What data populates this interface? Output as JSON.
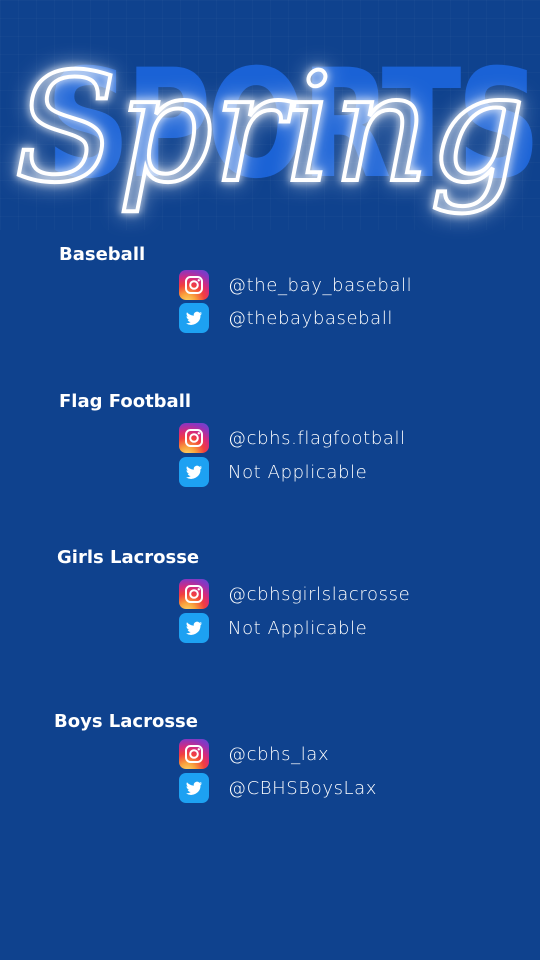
{
  "header": {
    "background_word": "SPORTS",
    "neon_word": "Spring"
  },
  "colors": {
    "background": "#0f428e",
    "background_word": "#1a62d6",
    "twitter": "#1da1f2",
    "text": "#ffffff"
  },
  "sports": [
    {
      "name": "Baseball",
      "instagram": "@the_bay_baseball",
      "twitter": "@thebaybaseball"
    },
    {
      "name": "Flag Football",
      "instagram": "@cbhs.flagfootball",
      "twitter": "Not Applicable"
    },
    {
      "name": "Girls Lacrosse",
      "instagram": "@cbhsgirlslacrosse",
      "twitter": "Not Applicable"
    },
    {
      "name": "Boys Lacrosse",
      "instagram": "@cbhs_lax",
      "twitter": "@CBHSBoysLax"
    }
  ],
  "icons": {
    "instagram": "instagram-icon",
    "twitter": "twitter-icon"
  }
}
